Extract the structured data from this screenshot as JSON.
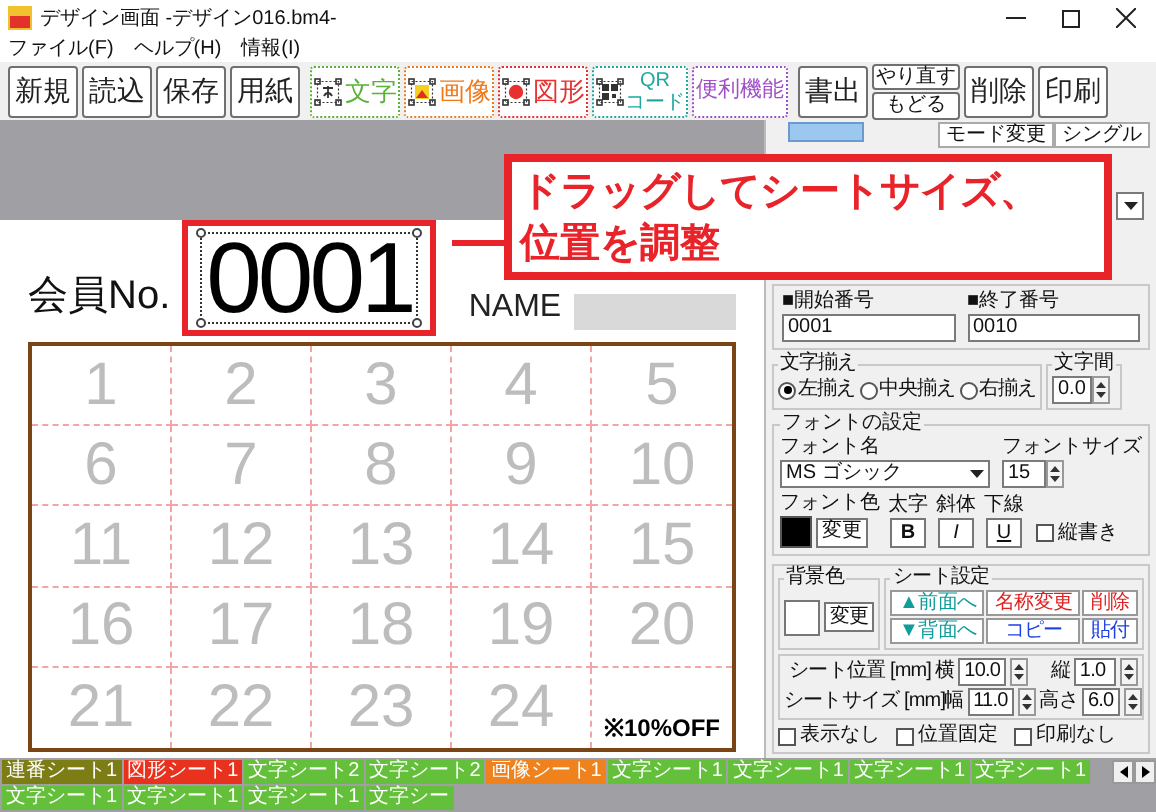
{
  "window": {
    "title": "デザイン画面 -デザイン016.bm4-"
  },
  "menu": [
    "ファイル(F)",
    "ヘルプ(H)",
    "情報(I)"
  ],
  "toolbar": [
    {
      "kind": "plain",
      "label": "新規"
    },
    {
      "kind": "plain",
      "label": "読込"
    },
    {
      "kind": "plain",
      "label": "保存"
    },
    {
      "kind": "plain",
      "label": "用紙"
    },
    {
      "kind": "text-tool",
      "label": "文字",
      "color": "#5bb23a"
    },
    {
      "kind": "image-tool",
      "label": "画像",
      "color": "#f07a1a"
    },
    {
      "kind": "shape-tool",
      "label": "図形",
      "color": "#e83030"
    },
    {
      "kind": "qr-tool",
      "label": "QR",
      "sublabel": "コード",
      "color": "#1ea7a0"
    },
    {
      "kind": "utility-tool",
      "label": "便利機能",
      "color": "#a050c8"
    },
    {
      "kind": "plain",
      "label": "書出"
    },
    {
      "kind": "stack",
      "labels": [
        "やり直す",
        "もどる"
      ]
    },
    {
      "kind": "plain",
      "label": "削除"
    },
    {
      "kind": "plain",
      "label": "印刷"
    }
  ],
  "canvas": {
    "member_label": "会員No.",
    "number": "0001",
    "name_label": "NAME",
    "cells": [
      "1",
      "2",
      "3",
      "4",
      "5",
      "6",
      "7",
      "8",
      "9",
      "10",
      "11",
      "12",
      "13",
      "14",
      "15",
      "16",
      "17",
      "18",
      "19",
      "20",
      "21",
      "22",
      "23",
      "24"
    ],
    "stamp": "※10%OFF"
  },
  "callout": {
    "lines": [
      "ドラッグしてシートサイズ、",
      "位置を調整"
    ]
  },
  "panel": {
    "mode_tabs": [
      "モード変更",
      "シングル"
    ],
    "serial": {
      "start_label": "■開始番号",
      "start": "0001",
      "end_label": "■終了番号",
      "end": "0010"
    },
    "align": {
      "title": "文字揃え",
      "options": [
        {
          "label": "左揃え",
          "selected": true
        },
        {
          "label": "中央揃え",
          "selected": false
        },
        {
          "label": "右揃え",
          "selected": false
        }
      ]
    },
    "spacing": {
      "title": "文字間",
      "value": "0.0"
    },
    "font": {
      "title": "フォントの設定",
      "name_label": "フォント名",
      "name": "MS ゴシック",
      "size_label": "フォントサイズ",
      "size": "15",
      "color_label": "フォント色",
      "color": "#000000",
      "change": "変更",
      "bold_label": "太字",
      "bold_button": "B",
      "italic_label": "斜体",
      "italic_button": "I",
      "underline_label": "下線",
      "underline_button": "U",
      "vertical": {
        "label": "縦書き",
        "checked": false
      }
    },
    "background": {
      "title": "背景色",
      "color": "#ffffff",
      "change": "変更"
    },
    "sheet": {
      "title": "シート設定",
      "buttons": [
        {
          "label": "▲前面へ",
          "color": "#139c9c"
        },
        {
          "label": "名称変更",
          "color": "#e02020"
        },
        {
          "label": "削除",
          "color": "#e02020"
        },
        {
          "label": "▼背面へ",
          "color": "#139c9c"
        },
        {
          "label": "コピー",
          "color": "#2040e0"
        },
        {
          "label": "貼付",
          "color": "#2040e0"
        }
      ]
    },
    "position": [
      {
        "label": "シート位置 [mm]",
        "a_label": "横",
        "a": "10.0",
        "b_label": "縦",
        "b": "1.0"
      },
      {
        "label": "シートサイズ [mm]",
        "a_label": "幅",
        "a": "11.0",
        "b_label": "高さ",
        "b": "6.0"
      }
    ],
    "checks": [
      {
        "label": "表示なし",
        "checked": false
      },
      {
        "label": "位置固定",
        "checked": false
      },
      {
        "label": "印刷なし",
        "checked": false
      }
    ]
  },
  "tabs": [
    {
      "label": "連番シート1",
      "color": "#7d7d16"
    },
    {
      "label": "図形シート1",
      "color": "#e8321e"
    },
    {
      "label": "文字シート2",
      "color": "#64c03a"
    },
    {
      "label": "文字シート2",
      "color": "#64c03a"
    },
    {
      "label": "画像シート1",
      "color": "#f0821e"
    },
    {
      "label": "文字シート1",
      "color": "#64c03a"
    },
    {
      "label": "文字シート1",
      "color": "#64c03a"
    },
    {
      "label": "文字シート1",
      "color": "#64c03a"
    },
    {
      "label": "文字シート1",
      "color": "#64c03a"
    },
    {
      "label": "文字シート1",
      "color": "#64c03a"
    },
    {
      "label": "文字シート1",
      "color": "#64c03a"
    },
    {
      "label": "文字シート1",
      "color": "#64c03a"
    },
    {
      "label": "文字シー",
      "color": "#64c03a"
    }
  ]
}
